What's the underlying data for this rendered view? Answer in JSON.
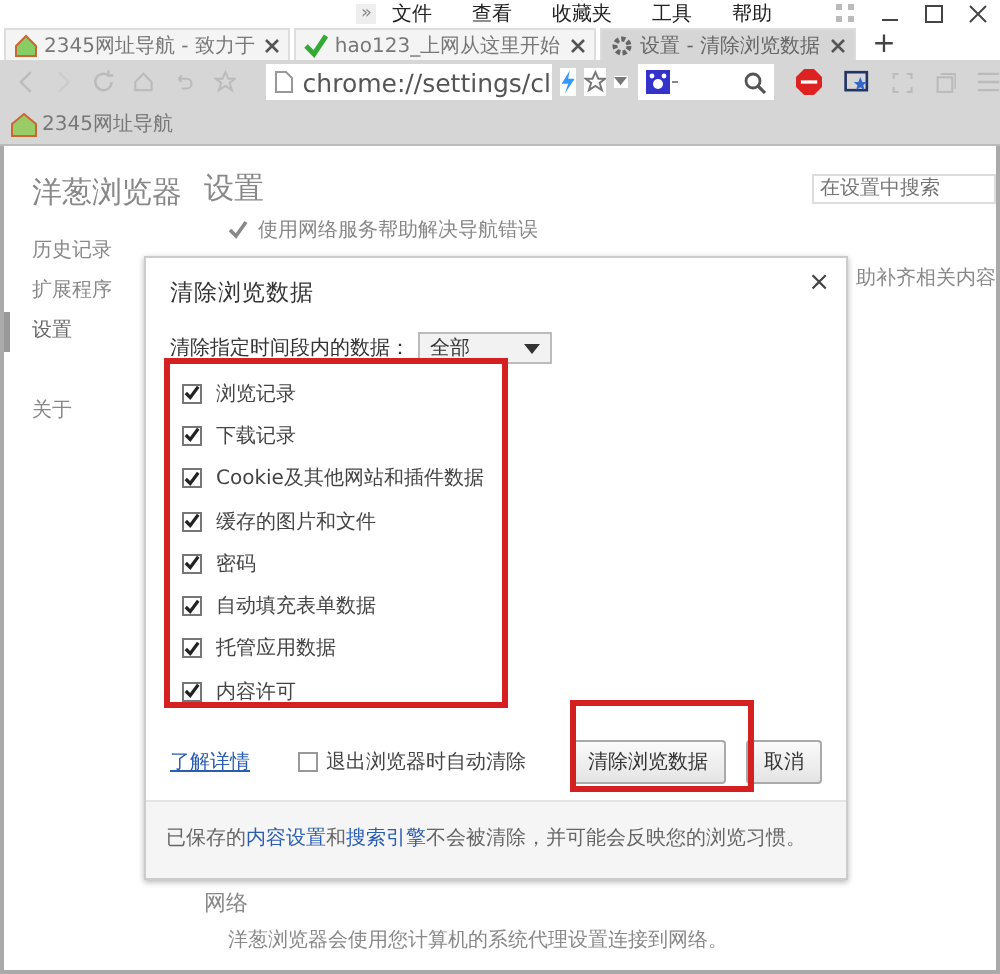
{
  "menu_bar": {
    "overflow": "»",
    "items": [
      "文件",
      "查看",
      "收藏夹",
      "工具",
      "帮助"
    ]
  },
  "tabs": [
    {
      "title": "2345网址导航 - 致力于",
      "selected": false
    },
    {
      "title": "hao123_上网从这里开始",
      "selected": false
    },
    {
      "title": "设置 - 清除浏览数据",
      "selected": true
    }
  ],
  "new_tab": "+",
  "address_bar": {
    "value": "chrome://settings/cl"
  },
  "bookmarks": [
    {
      "label": "2345网址导航"
    }
  ],
  "settings_page": {
    "brand": "洋葱浏览器",
    "heading": "设置",
    "search": {
      "placeholder": "在设置中搜索"
    },
    "sidebar": [
      {
        "label": "历史记录",
        "selected": false
      },
      {
        "label": "扩展程序",
        "selected": false
      },
      {
        "label": "设置",
        "selected": true
      },
      {
        "label": "关于",
        "selected": false
      }
    ],
    "option": {
      "label": "使用网络服务帮助解决导航错误",
      "checked": true
    },
    "partial_text": "助补齐相关内容",
    "network": {
      "title": "网络",
      "description": "洋葱浏览器会使用您计算机的系统代理设置连接到网络。"
    }
  },
  "dialog": {
    "title": "清除浏览数据",
    "close": "×",
    "range_label": "清除指定时间段内的数据：",
    "range_value": "全部",
    "items": [
      {
        "label": "浏览记录",
        "checked": true
      },
      {
        "label": "下载记录",
        "checked": true
      },
      {
        "label": "Cookie及其他网站和插件数据",
        "checked": true
      },
      {
        "label": "缓存的图片和文件",
        "checked": true
      },
      {
        "label": "密码",
        "checked": true
      },
      {
        "label": "自动填充表单数据",
        "checked": true
      },
      {
        "label": "托管应用数据",
        "checked": true
      },
      {
        "label": "内容许可",
        "checked": true
      }
    ],
    "learn_more": "了解详情",
    "auto_clear": {
      "label": "退出浏览器时自动清除",
      "checked": false
    },
    "buttons": [
      "清除浏览数据",
      "取消"
    ],
    "notice": [
      {
        "text": "已保存的",
        "link": false
      },
      {
        "text": "内容设置",
        "link": true
      },
      {
        "text": "和",
        "link": false
      },
      {
        "text": "搜索引擎",
        "link": true
      },
      {
        "text": "不会被清除，并可能会反映您的浏览习惯。",
        "link": false
      }
    ]
  }
}
